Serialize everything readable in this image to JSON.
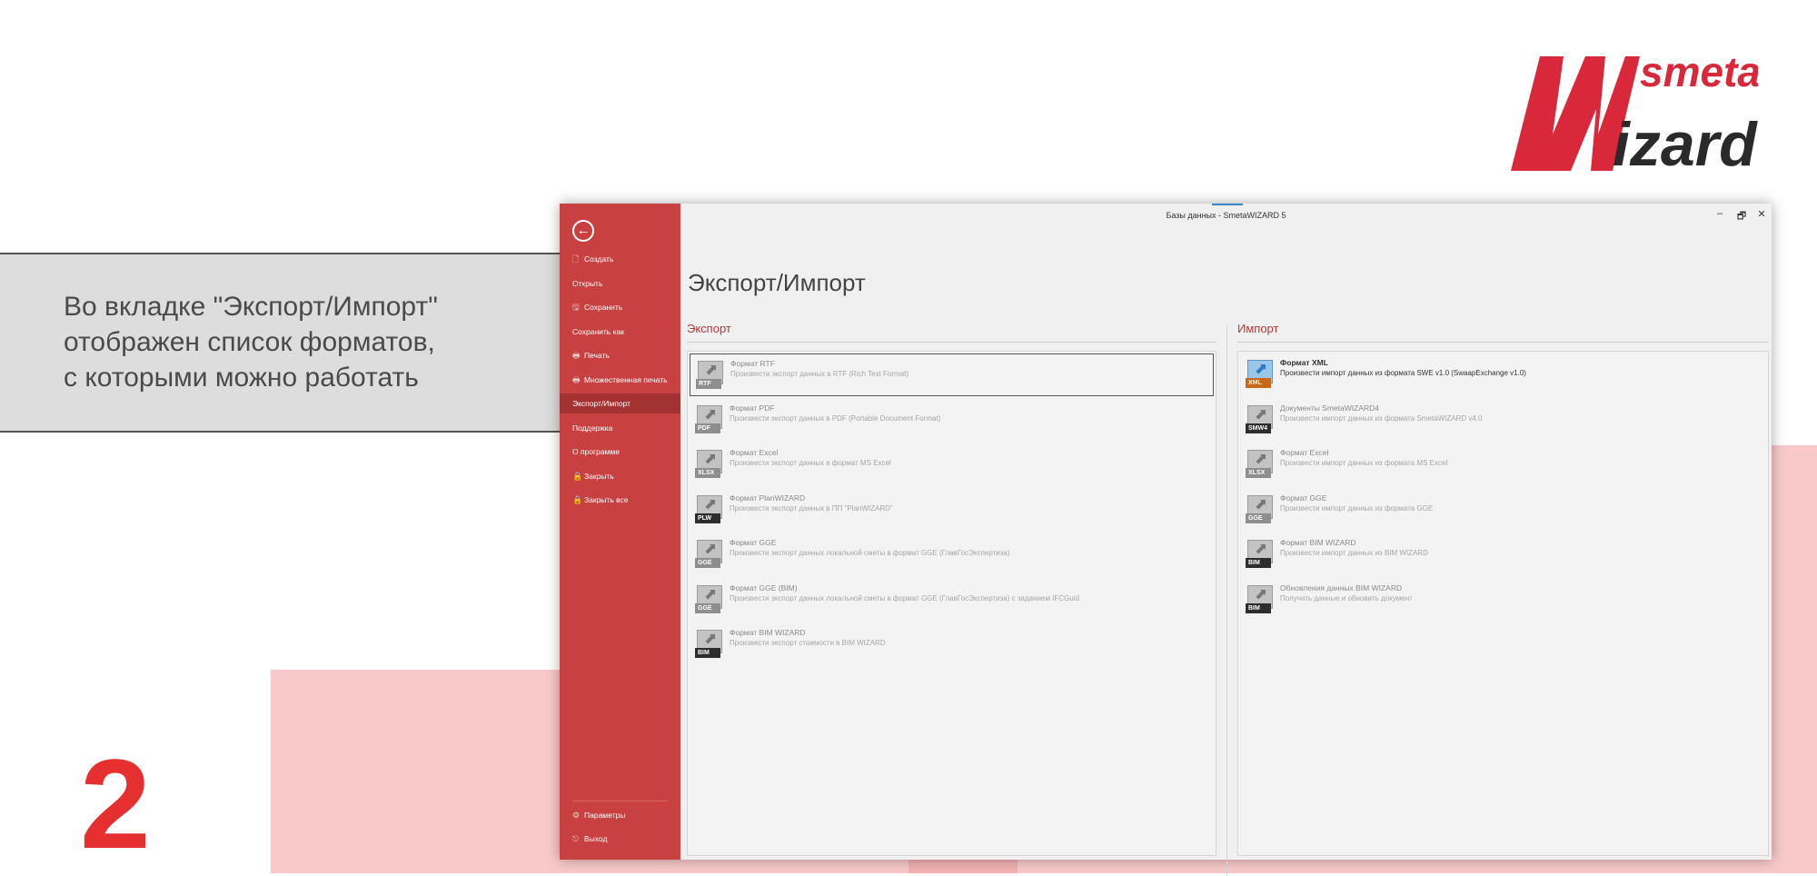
{
  "slide": {
    "callout_lines": [
      "Во вкладке \"Экспорт/Импорт\"",
      "отображен список форматов,",
      "с которыми можно работать"
    ],
    "step_number": "2",
    "logo": {
      "word_top": "smeta",
      "word_bottom": "Wizard"
    }
  },
  "window": {
    "title": "Базы данных - SmetaWIZARD 5",
    "controls": {
      "minimize": "–",
      "restore": "🗗",
      "close": "✕"
    }
  },
  "sidebar": {
    "back_glyph": "←",
    "items": [
      {
        "label": "Создать",
        "icon": "new-doc-icon"
      },
      {
        "label": "Открыть",
        "icon": ""
      },
      {
        "label": "Сохранить",
        "icon": "save-icon"
      },
      {
        "label": "Сохранить как",
        "icon": ""
      },
      {
        "label": "Печать",
        "icon": "print-icon"
      },
      {
        "label": "Множественная печать",
        "icon": "multi-print-icon"
      },
      {
        "label": "Экспорт/Импорт",
        "icon": "",
        "active": true
      },
      {
        "label": "Поддержка",
        "icon": ""
      },
      {
        "label": "О программе",
        "icon": ""
      },
      {
        "label": "Закрыть",
        "icon": "lock-icon"
      },
      {
        "label": "Закрыть все",
        "icon": "lock-icon"
      }
    ],
    "bottom_items": [
      {
        "label": "Параметры",
        "icon": "settings-icon"
      },
      {
        "label": "Выход",
        "icon": "exit-icon"
      }
    ]
  },
  "main": {
    "title": "Экспорт/Импорт",
    "export": {
      "title": "Экспорт",
      "formats": [
        {
          "tag": "RTF",
          "name": "Формат RTF",
          "desc": "Произвести экспорт данных в RTF (Rich Text Format)",
          "selected": true
        },
        {
          "tag": "PDF",
          "name": "Формат PDF",
          "desc": "Произвести экспорт данных в PDF (Portable Document Format)"
        },
        {
          "tag": "XLSX",
          "name": "Формат Excel",
          "desc": "Произвести экспорт данных в формат МS Excel"
        },
        {
          "tag": "PLW",
          "name": "Формат PlanWIZARD",
          "desc": "Произвести экспорт данных в ПП \"PlanWIZARD\"",
          "dark": true
        },
        {
          "tag": "GGE",
          "name": "Формат GGE",
          "desc": "Произвести экспорт данных локальной сметы в формат GGE (ГлавГосЭкспертиза)"
        },
        {
          "tag": "GGE",
          "name": "Формат GGE (BIM)",
          "desc": "Произвести экспорт данных локальной сметы в формат GGE (ГлавГосЭкспертиза) с заданием IFCGuid"
        },
        {
          "tag": "BIM",
          "name": "Формат BIM WIZARD",
          "desc": "Произвести экспорт стоимости в BIM WIZARD",
          "dark": true
        }
      ]
    },
    "import": {
      "title": "Импорт",
      "formats": [
        {
          "tag": "XML",
          "name": "Формат XML",
          "desc": "Произвести импорт данных из формата SWE v1.0 (SwaapExchange v1.0)",
          "enabled": true,
          "orange": true
        },
        {
          "tag": "SMW4",
          "name": "Документы SmetaWIZARD4",
          "desc": "Произвести импорт данных из формата SmetaWIZARD v4.0",
          "dark": true
        },
        {
          "tag": "XLSX",
          "name": "Формат Excel",
          "desc": "Произвести импорт данных из формата MS Excel"
        },
        {
          "tag": "GGE",
          "name": "Формат GGE",
          "desc": "Произвести импорт данных из формата GGE"
        },
        {
          "tag": "BIM",
          "name": "Формат BIM WIZARD",
          "desc": "Произвести импорт данных из BIM WIZARD",
          "dark": true
        },
        {
          "tag": "BIM",
          "name": "Обновления данных BIM WIZARD",
          "desc": "Получить данные и обновить документ",
          "dark": true
        }
      ]
    }
  },
  "colors": {
    "accent": "#c8403f",
    "accent_active": "#a33232",
    "step_red": "#e63030",
    "pink": "#f9c9c9"
  }
}
